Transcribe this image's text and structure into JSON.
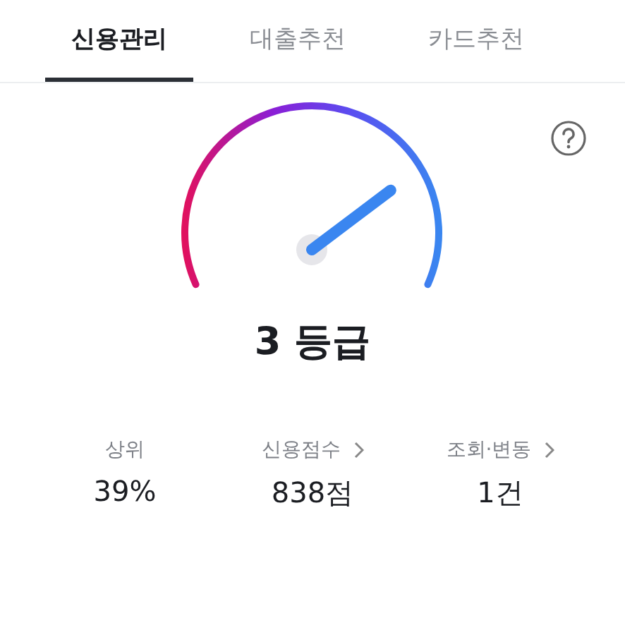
{
  "tabs": [
    {
      "label": "신용관리",
      "selected": true
    },
    {
      "label": "대출추천",
      "selected": false
    },
    {
      "label": "카드추천",
      "selected": false
    }
  ],
  "gauge": {
    "grade": "3 등급"
  },
  "stats": [
    {
      "label": "상위",
      "link": false,
      "value": "39%"
    },
    {
      "label": "신용점수",
      "link": true,
      "value": "838점"
    },
    {
      "label": "조회·변동",
      "link": true,
      "value": "1건"
    }
  ]
}
